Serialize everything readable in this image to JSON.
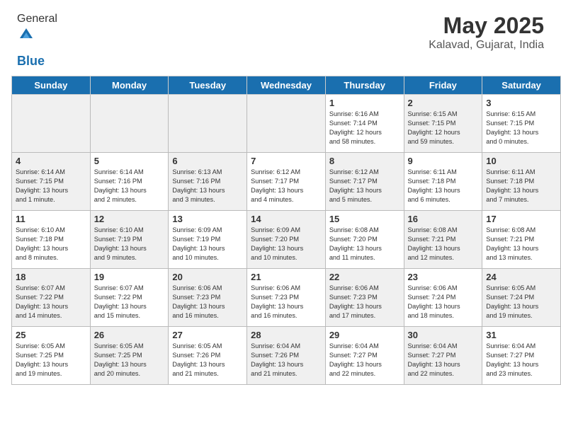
{
  "header": {
    "logo_general": "General",
    "logo_blue": "Blue",
    "title": "May 2025",
    "subtitle": "Kalavad, Gujarat, India"
  },
  "days_of_week": [
    "Sunday",
    "Monday",
    "Tuesday",
    "Wednesday",
    "Thursday",
    "Friday",
    "Saturday"
  ],
  "weeks": [
    [
      {
        "day": "",
        "info": "",
        "shaded": true
      },
      {
        "day": "",
        "info": "",
        "shaded": true
      },
      {
        "day": "",
        "info": "",
        "shaded": true
      },
      {
        "day": "",
        "info": "",
        "shaded": true
      },
      {
        "day": "1",
        "info": "Sunrise: 6:16 AM\nSunset: 7:14 PM\nDaylight: 12 hours\nand 58 minutes."
      },
      {
        "day": "2",
        "info": "Sunrise: 6:15 AM\nSunset: 7:15 PM\nDaylight: 12 hours\nand 59 minutes.",
        "shaded": true
      },
      {
        "day": "3",
        "info": "Sunrise: 6:15 AM\nSunset: 7:15 PM\nDaylight: 13 hours\nand 0 minutes."
      }
    ],
    [
      {
        "day": "4",
        "info": "Sunrise: 6:14 AM\nSunset: 7:15 PM\nDaylight: 13 hours\nand 1 minute.",
        "shaded": true
      },
      {
        "day": "5",
        "info": "Sunrise: 6:14 AM\nSunset: 7:16 PM\nDaylight: 13 hours\nand 2 minutes."
      },
      {
        "day": "6",
        "info": "Sunrise: 6:13 AM\nSunset: 7:16 PM\nDaylight: 13 hours\nand 3 minutes.",
        "shaded": true
      },
      {
        "day": "7",
        "info": "Sunrise: 6:12 AM\nSunset: 7:17 PM\nDaylight: 13 hours\nand 4 minutes."
      },
      {
        "day": "8",
        "info": "Sunrise: 6:12 AM\nSunset: 7:17 PM\nDaylight: 13 hours\nand 5 minutes.",
        "shaded": true
      },
      {
        "day": "9",
        "info": "Sunrise: 6:11 AM\nSunset: 7:18 PM\nDaylight: 13 hours\nand 6 minutes."
      },
      {
        "day": "10",
        "info": "Sunrise: 6:11 AM\nSunset: 7:18 PM\nDaylight: 13 hours\nand 7 minutes.",
        "shaded": true
      }
    ],
    [
      {
        "day": "11",
        "info": "Sunrise: 6:10 AM\nSunset: 7:18 PM\nDaylight: 13 hours\nand 8 minutes."
      },
      {
        "day": "12",
        "info": "Sunrise: 6:10 AM\nSunset: 7:19 PM\nDaylight: 13 hours\nand 9 minutes.",
        "shaded": true
      },
      {
        "day": "13",
        "info": "Sunrise: 6:09 AM\nSunset: 7:19 PM\nDaylight: 13 hours\nand 10 minutes."
      },
      {
        "day": "14",
        "info": "Sunrise: 6:09 AM\nSunset: 7:20 PM\nDaylight: 13 hours\nand 10 minutes.",
        "shaded": true
      },
      {
        "day": "15",
        "info": "Sunrise: 6:08 AM\nSunset: 7:20 PM\nDaylight: 13 hours\nand 11 minutes."
      },
      {
        "day": "16",
        "info": "Sunrise: 6:08 AM\nSunset: 7:21 PM\nDaylight: 13 hours\nand 12 minutes.",
        "shaded": true
      },
      {
        "day": "17",
        "info": "Sunrise: 6:08 AM\nSunset: 7:21 PM\nDaylight: 13 hours\nand 13 minutes."
      }
    ],
    [
      {
        "day": "18",
        "info": "Sunrise: 6:07 AM\nSunset: 7:22 PM\nDaylight: 13 hours\nand 14 minutes.",
        "shaded": true
      },
      {
        "day": "19",
        "info": "Sunrise: 6:07 AM\nSunset: 7:22 PM\nDaylight: 13 hours\nand 15 minutes."
      },
      {
        "day": "20",
        "info": "Sunrise: 6:06 AM\nSunset: 7:23 PM\nDaylight: 13 hours\nand 16 minutes.",
        "shaded": true
      },
      {
        "day": "21",
        "info": "Sunrise: 6:06 AM\nSunset: 7:23 PM\nDaylight: 13 hours\nand 16 minutes."
      },
      {
        "day": "22",
        "info": "Sunrise: 6:06 AM\nSunset: 7:23 PM\nDaylight: 13 hours\nand 17 minutes.",
        "shaded": true
      },
      {
        "day": "23",
        "info": "Sunrise: 6:06 AM\nSunset: 7:24 PM\nDaylight: 13 hours\nand 18 minutes."
      },
      {
        "day": "24",
        "info": "Sunrise: 6:05 AM\nSunset: 7:24 PM\nDaylight: 13 hours\nand 19 minutes.",
        "shaded": true
      }
    ],
    [
      {
        "day": "25",
        "info": "Sunrise: 6:05 AM\nSunset: 7:25 PM\nDaylight: 13 hours\nand 19 minutes."
      },
      {
        "day": "26",
        "info": "Sunrise: 6:05 AM\nSunset: 7:25 PM\nDaylight: 13 hours\nand 20 minutes.",
        "shaded": true
      },
      {
        "day": "27",
        "info": "Sunrise: 6:05 AM\nSunset: 7:26 PM\nDaylight: 13 hours\nand 21 minutes."
      },
      {
        "day": "28",
        "info": "Sunrise: 6:04 AM\nSunset: 7:26 PM\nDaylight: 13 hours\nand 21 minutes.",
        "shaded": true
      },
      {
        "day": "29",
        "info": "Sunrise: 6:04 AM\nSunset: 7:27 PM\nDaylight: 13 hours\nand 22 minutes."
      },
      {
        "day": "30",
        "info": "Sunrise: 6:04 AM\nSunset: 7:27 PM\nDaylight: 13 hours\nand 22 minutes.",
        "shaded": true
      },
      {
        "day": "31",
        "info": "Sunrise: 6:04 AM\nSunset: 7:27 PM\nDaylight: 13 hours\nand 23 minutes."
      }
    ]
  ]
}
